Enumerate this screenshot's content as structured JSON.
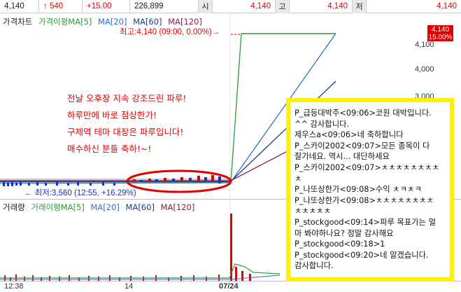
{
  "quote_bar": {
    "price": "4,140",
    "change": "↑ 540",
    "change_pct": "+15.00",
    "volume": "226,899",
    "open_label": "시",
    "open_value": "4,140",
    "high_label": "고",
    "high_value": "4,140",
    "low_label": "저",
    "low_value": "4,140"
  },
  "price_chart": {
    "legend": {
      "title": "가격차트",
      "ma_label": "가격이평MA[5]",
      "ma20": "MA[20]",
      "ma60": "MA[60]",
      "ma120": "MA[120]"
    },
    "high_label": "최고:4,140 (09:00, 0.00%)→",
    "low_label": "← 최저:3,560 (12:55, +16.29%)",
    "badge_price": "4,140",
    "badge_pct": "15.00%",
    "axis_ticks": [
      "4,100",
      "4,000",
      "3,000"
    ],
    "annotation": [
      "전날 오후장 지속 강조드린 파루!",
      "하루만에 바로 점상한가!",
      "구제역 테마 대장은 파루입니다!",
      "매수하신 분들 축하!~!"
    ]
  },
  "volume_chart": {
    "legend": {
      "title": "거래량",
      "ma_label": "거래이평MA[5]",
      "ma20": "MA[20]",
      "ma60": "MA[60]",
      "ma120": "MA[120]"
    }
  },
  "x_axis": {
    "labels": [
      "12:38",
      "14",
      "07/24"
    ]
  },
  "chat": {
    "lines": [
      "P_급등대박주<09:06>코원 대박입니다.",
      "^^ 감사합니다.",
      "제우스a<09:06>네 축하합니다",
      "P_스카이2002<09:07>모든 종목이 다",
      "잘가네요. 역시... 대단하세요",
      "P_스카이2002<09:07>ㅊㅊㅊㅊㅊㅊㅊㅊ",
      "ㅊ",
      "P_나또상한가<09:08>수익 ㅊㅋㅊㅋ",
      "P_나또상한가<09:08>ㅊㅊㅊㅊㅊㅊㅊㅊ",
      "ㅊㅊㅊㅊㅊ",
      "P_stockgood<09:14>파루 목표가는 얼",
      "마 봐야하나요? 정말 감사해요",
      "P_stockgood<09:18>1",
      "P_stockgood<09:20>네 알겠습니다.",
      "감사합니다."
    ]
  },
  "colors": {
    "up": "#e00000",
    "ma5": "#2c9b3a",
    "ma20": "#2f6fd6",
    "ma60": "#1f3b8c",
    "ma120": "#8a1d4e",
    "highlight_border": "#fff200"
  }
}
